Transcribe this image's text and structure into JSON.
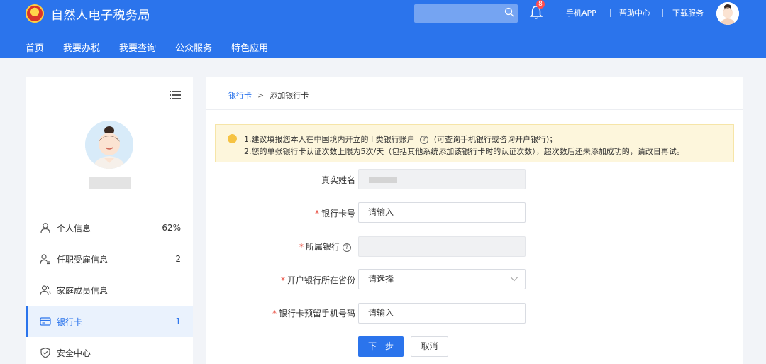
{
  "header": {
    "title": "自然人电子税务局",
    "notification_count": "8",
    "links": [
      "手机APP",
      "帮助中心",
      "下载服务"
    ],
    "nav": [
      "首页",
      "我要办税",
      "我要查询",
      "公众服务",
      "特色应用"
    ]
  },
  "sidebar": {
    "items": [
      {
        "label": "个人信息",
        "count": "62%",
        "icon": "person-icon"
      },
      {
        "label": "任职受雇信息",
        "count": "2",
        "icon": "person-list-icon"
      },
      {
        "label": "家庭成员信息",
        "count": "",
        "icon": "family-icon"
      },
      {
        "label": "银行卡",
        "count": "1",
        "icon": "card-icon",
        "active": true
      },
      {
        "label": "安全中心",
        "count": "",
        "icon": "shield-icon"
      }
    ]
  },
  "breadcrumb": {
    "parent": "银行卡",
    "separator": ">",
    "current": "添加银行卡"
  },
  "notice": {
    "line1_a": "1.建议填报您本人在中国境内开立的 I 类银行账户",
    "line1_b": "(可查询手机银行或咨询开户银行)；",
    "line2": "2.您的单张银行卡认证次数上限为5次/天（包括其他系统添加该银行卡时的认证次数），超次数后还未添加成功的，请改日再试。"
  },
  "form": {
    "required_mark": "*",
    "help_glyph": "?",
    "real_name_label": "真实姓名",
    "card_number_label": "银行卡号",
    "card_number_placeholder": "请输入",
    "bank_label": "所属银行",
    "province_label": "开户银行所在省份",
    "province_placeholder": "请选择",
    "phone_label": "银行卡预留手机号码",
    "phone_placeholder": "请输入",
    "next_button": "下一步",
    "cancel_button": "取消"
  },
  "colors": {
    "primary": "#2b74ec",
    "notice_bg": "#fdf6dc",
    "required": "#e84a3c"
  }
}
